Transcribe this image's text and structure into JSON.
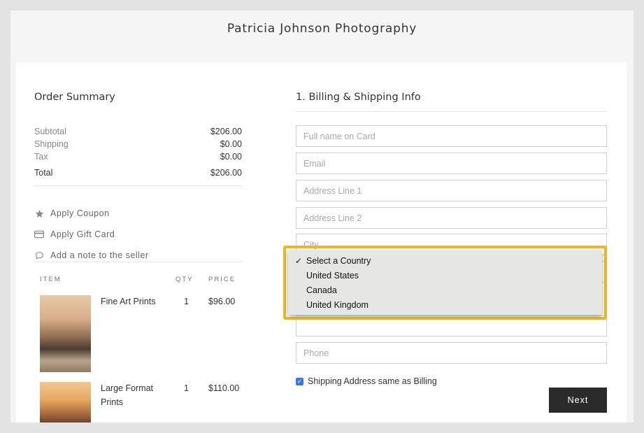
{
  "brand": "Patricia Johnson Photography",
  "summary": {
    "title": "Order Summary",
    "rows": [
      {
        "label": "Subtotal",
        "value": "$206.00"
      },
      {
        "label": "Shipping",
        "value": "$0.00"
      },
      {
        "label": "Tax",
        "value": "$0.00"
      },
      {
        "label": "Total",
        "value": "$206.00"
      }
    ],
    "actions": [
      {
        "icon": "star-icon",
        "label": "Apply Coupon"
      },
      {
        "icon": "credit-card-icon",
        "label": "Apply Gift Card"
      },
      {
        "icon": "speech-bubble-icon",
        "label": "Add a note to the seller"
      }
    ],
    "table_headers": {
      "item": "ITEM",
      "qty": "QTY",
      "price": "PRICE"
    },
    "items": [
      {
        "name": "Fine Art Prints",
        "qty": "1",
        "price": "$96.00"
      },
      {
        "name": "Large Format Prints",
        "qty": "1",
        "price": "$110.00"
      }
    ]
  },
  "billing": {
    "title": "1. Billing & Shipping Info",
    "placeholders": {
      "full_name": "Full name on Card",
      "email": "Email",
      "address1": "Address Line 1",
      "address2": "Address Line 2",
      "city": "City",
      "phone": "Phone"
    },
    "shipping_same_label": "Shipping Address same as Billing",
    "shipping_same_checked": true,
    "next_label": "Next"
  },
  "country_dropdown": {
    "selected": "Select a Country",
    "options": [
      "Select a Country",
      "United States",
      "Canada",
      "United Kingdom"
    ],
    "highlight_color": "#f3b61f"
  },
  "colors": {
    "accent": "#3478f6",
    "button": "#2b2b2b"
  }
}
